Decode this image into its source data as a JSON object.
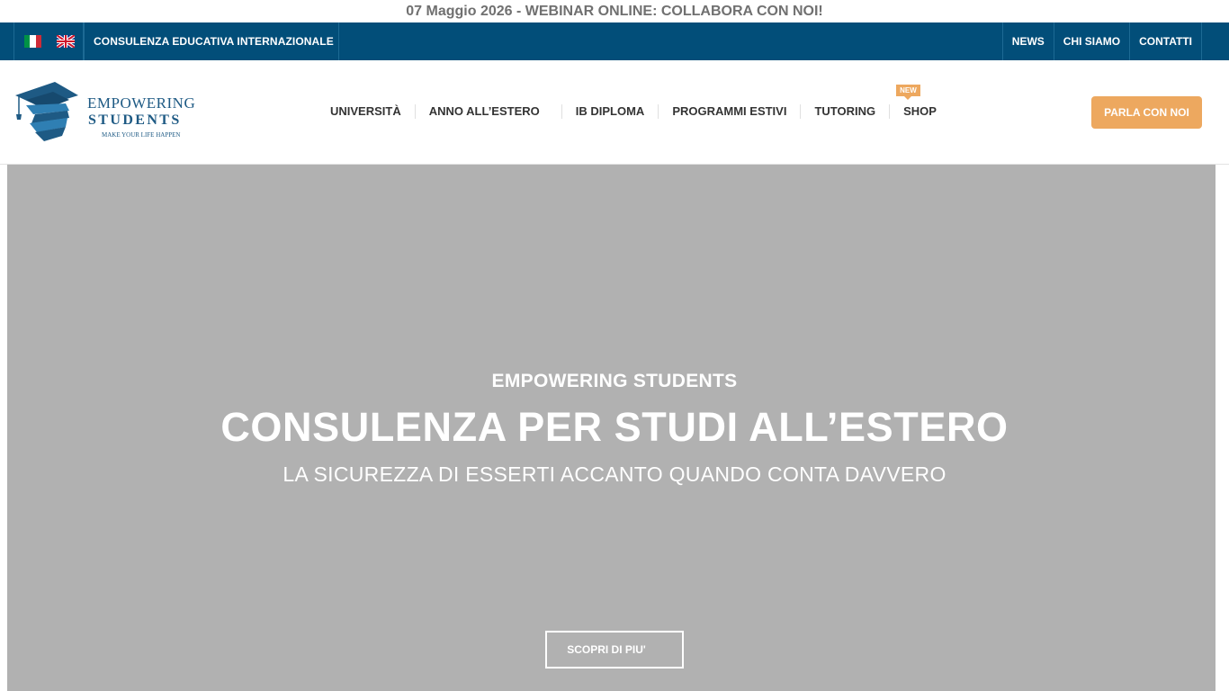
{
  "announcement": "07 Maggio 2026 - WEBINAR ONLINE: COLLABORA CON NOI!",
  "topbar": {
    "flags": [
      "italian-flag-icon",
      "uk-flag-icon"
    ],
    "tagline": "CONSULENZA EDUCATIVA INTERNAZIONALE",
    "links": [
      "NEWS",
      "CHI SIAMO",
      "CONTATTI"
    ]
  },
  "logo": {
    "line1": "EMPOWERING",
    "line2": "STUDENTS",
    "line3": "MAKE YOUR LIFE HAPPEN"
  },
  "nav": {
    "items": [
      "UNIVERSITÀ",
      "ANNO ALL’ESTERO",
      "IB DIPLOMA",
      "PROGRAMMI ESTIVI",
      "TUTORING",
      "SHOP"
    ],
    "badge": "NEW"
  },
  "cta": "PARLA CON NOI",
  "hero": {
    "eyebrow": "EMPOWERING STUDENTS",
    "title": "CONSULENZA PER STUDI ALL’ESTERO",
    "subtitle": "LA SICUREZZA DI ESSERTI ACCANTO QUANDO CONTA DAVVERO",
    "button": "SCOPRI DI PIU'"
  },
  "colors": {
    "topbar": "#024e79",
    "accent": "#eda85f",
    "hero_bg": "#b1b1b1",
    "logo": "#1e5a84"
  }
}
